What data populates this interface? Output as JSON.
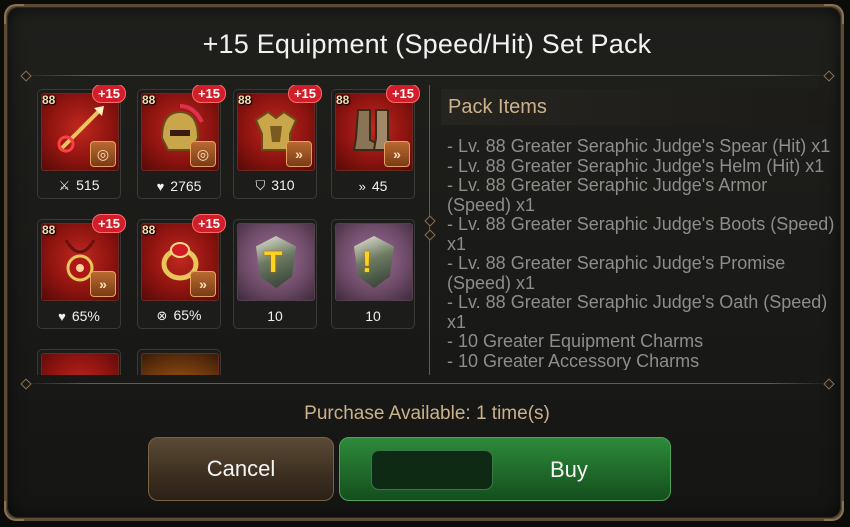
{
  "dialog": {
    "title": "+15 Equipment (Speed/Hit) Set Pack",
    "purchase_text": "Purchase Available: 1 time(s)"
  },
  "items": [
    {
      "level": "88",
      "upgrade": "+15",
      "stat_icon": "sword-icon",
      "stat_glyph": "⚔",
      "stat_value": "515",
      "set_icon": "hit-set-icon",
      "set_glyph": "◎"
    },
    {
      "level": "88",
      "upgrade": "+15",
      "stat_icon": "heart-icon",
      "stat_glyph": "♥",
      "stat_value": "2765",
      "set_icon": "hit-set-icon",
      "set_glyph": "◎"
    },
    {
      "level": "88",
      "upgrade": "+15",
      "stat_icon": "shield-icon",
      "stat_glyph": "⛉",
      "stat_value": "310",
      "set_icon": "speed-set-icon",
      "set_glyph": "»"
    },
    {
      "level": "88",
      "upgrade": "+15",
      "stat_icon": "speed-arrow-icon",
      "stat_glyph": "»",
      "stat_value": "45",
      "set_icon": "speed-set-icon",
      "set_glyph": "»"
    },
    {
      "level": "88",
      "upgrade": "+15",
      "stat_icon": "heart-icon",
      "stat_glyph": "♥",
      "stat_value": "65%",
      "set_icon": "speed-set-icon",
      "set_glyph": "»"
    },
    {
      "level": "88",
      "upgrade": "+15",
      "stat_icon": "target-icon",
      "stat_glyph": "⊗",
      "stat_value": "65%",
      "set_icon": "speed-set-icon",
      "set_glyph": "»"
    },
    {
      "count": "10",
      "icon": "equipment-charm-icon"
    },
    {
      "count": "10",
      "icon": "accessory-charm-icon"
    }
  ],
  "pack_items": {
    "heading": "Pack Items",
    "lines": [
      "- Lv. 88 Greater Seraphic Judge's Spear (Hit) x1",
      "- Lv. 88 Greater Seraphic Judge's Helm (Hit) x1",
      "- Lv. 88 Greater Seraphic Judge's Armor (Speed) x1",
      "- Lv. 88 Greater Seraphic Judge's Boots (Speed) x1",
      "- Lv. 88 Greater Seraphic Judge's Promise (Speed) x1",
      "- Lv. 88 Greater Seraphic Judge's Oath (Speed) x1",
      "- 10 Greater Equipment Charms",
      "- 10 Greater Accessory Charms"
    ]
  },
  "buttons": {
    "cancel": "Cancel",
    "buy": "Buy"
  },
  "colors": {
    "tile_red": "#a3161a",
    "upgrade_badge": "#d21d2a",
    "heading_gold": "#cbb28a",
    "buy_green": "#1f6a2a",
    "cancel_brown": "#3d2f20"
  }
}
